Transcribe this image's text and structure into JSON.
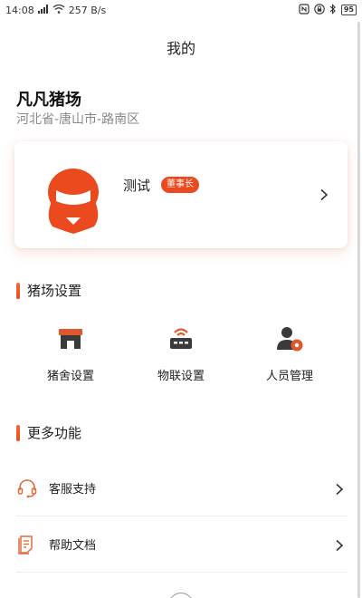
{
  "status_bar": {
    "time": "14:08",
    "network_speed": "257 B/s",
    "battery": "95"
  },
  "page": {
    "title": "我的"
  },
  "farm": {
    "name": "凡凡猪场",
    "region": "河北省-唐山市-路南区"
  },
  "user": {
    "name": "测试",
    "role": "董事长"
  },
  "pig_farm_settings": {
    "title": "猪场设置",
    "items": [
      {
        "label": "猪舍设置",
        "icon": "barn-icon"
      },
      {
        "label": "物联设置",
        "icon": "router-icon"
      },
      {
        "label": "人员管理",
        "icon": "user-gear-icon"
      }
    ]
  },
  "more_functions": {
    "title": "更多功能",
    "items": [
      {
        "label": "客服支持",
        "icon": "headset-icon"
      },
      {
        "label": "帮助文档",
        "icon": "document-icon"
      }
    ]
  },
  "colors": {
    "accent": "#ea4a1e",
    "icon_dark": "#3a3a3a",
    "icon_outline": "#e06a3a"
  }
}
